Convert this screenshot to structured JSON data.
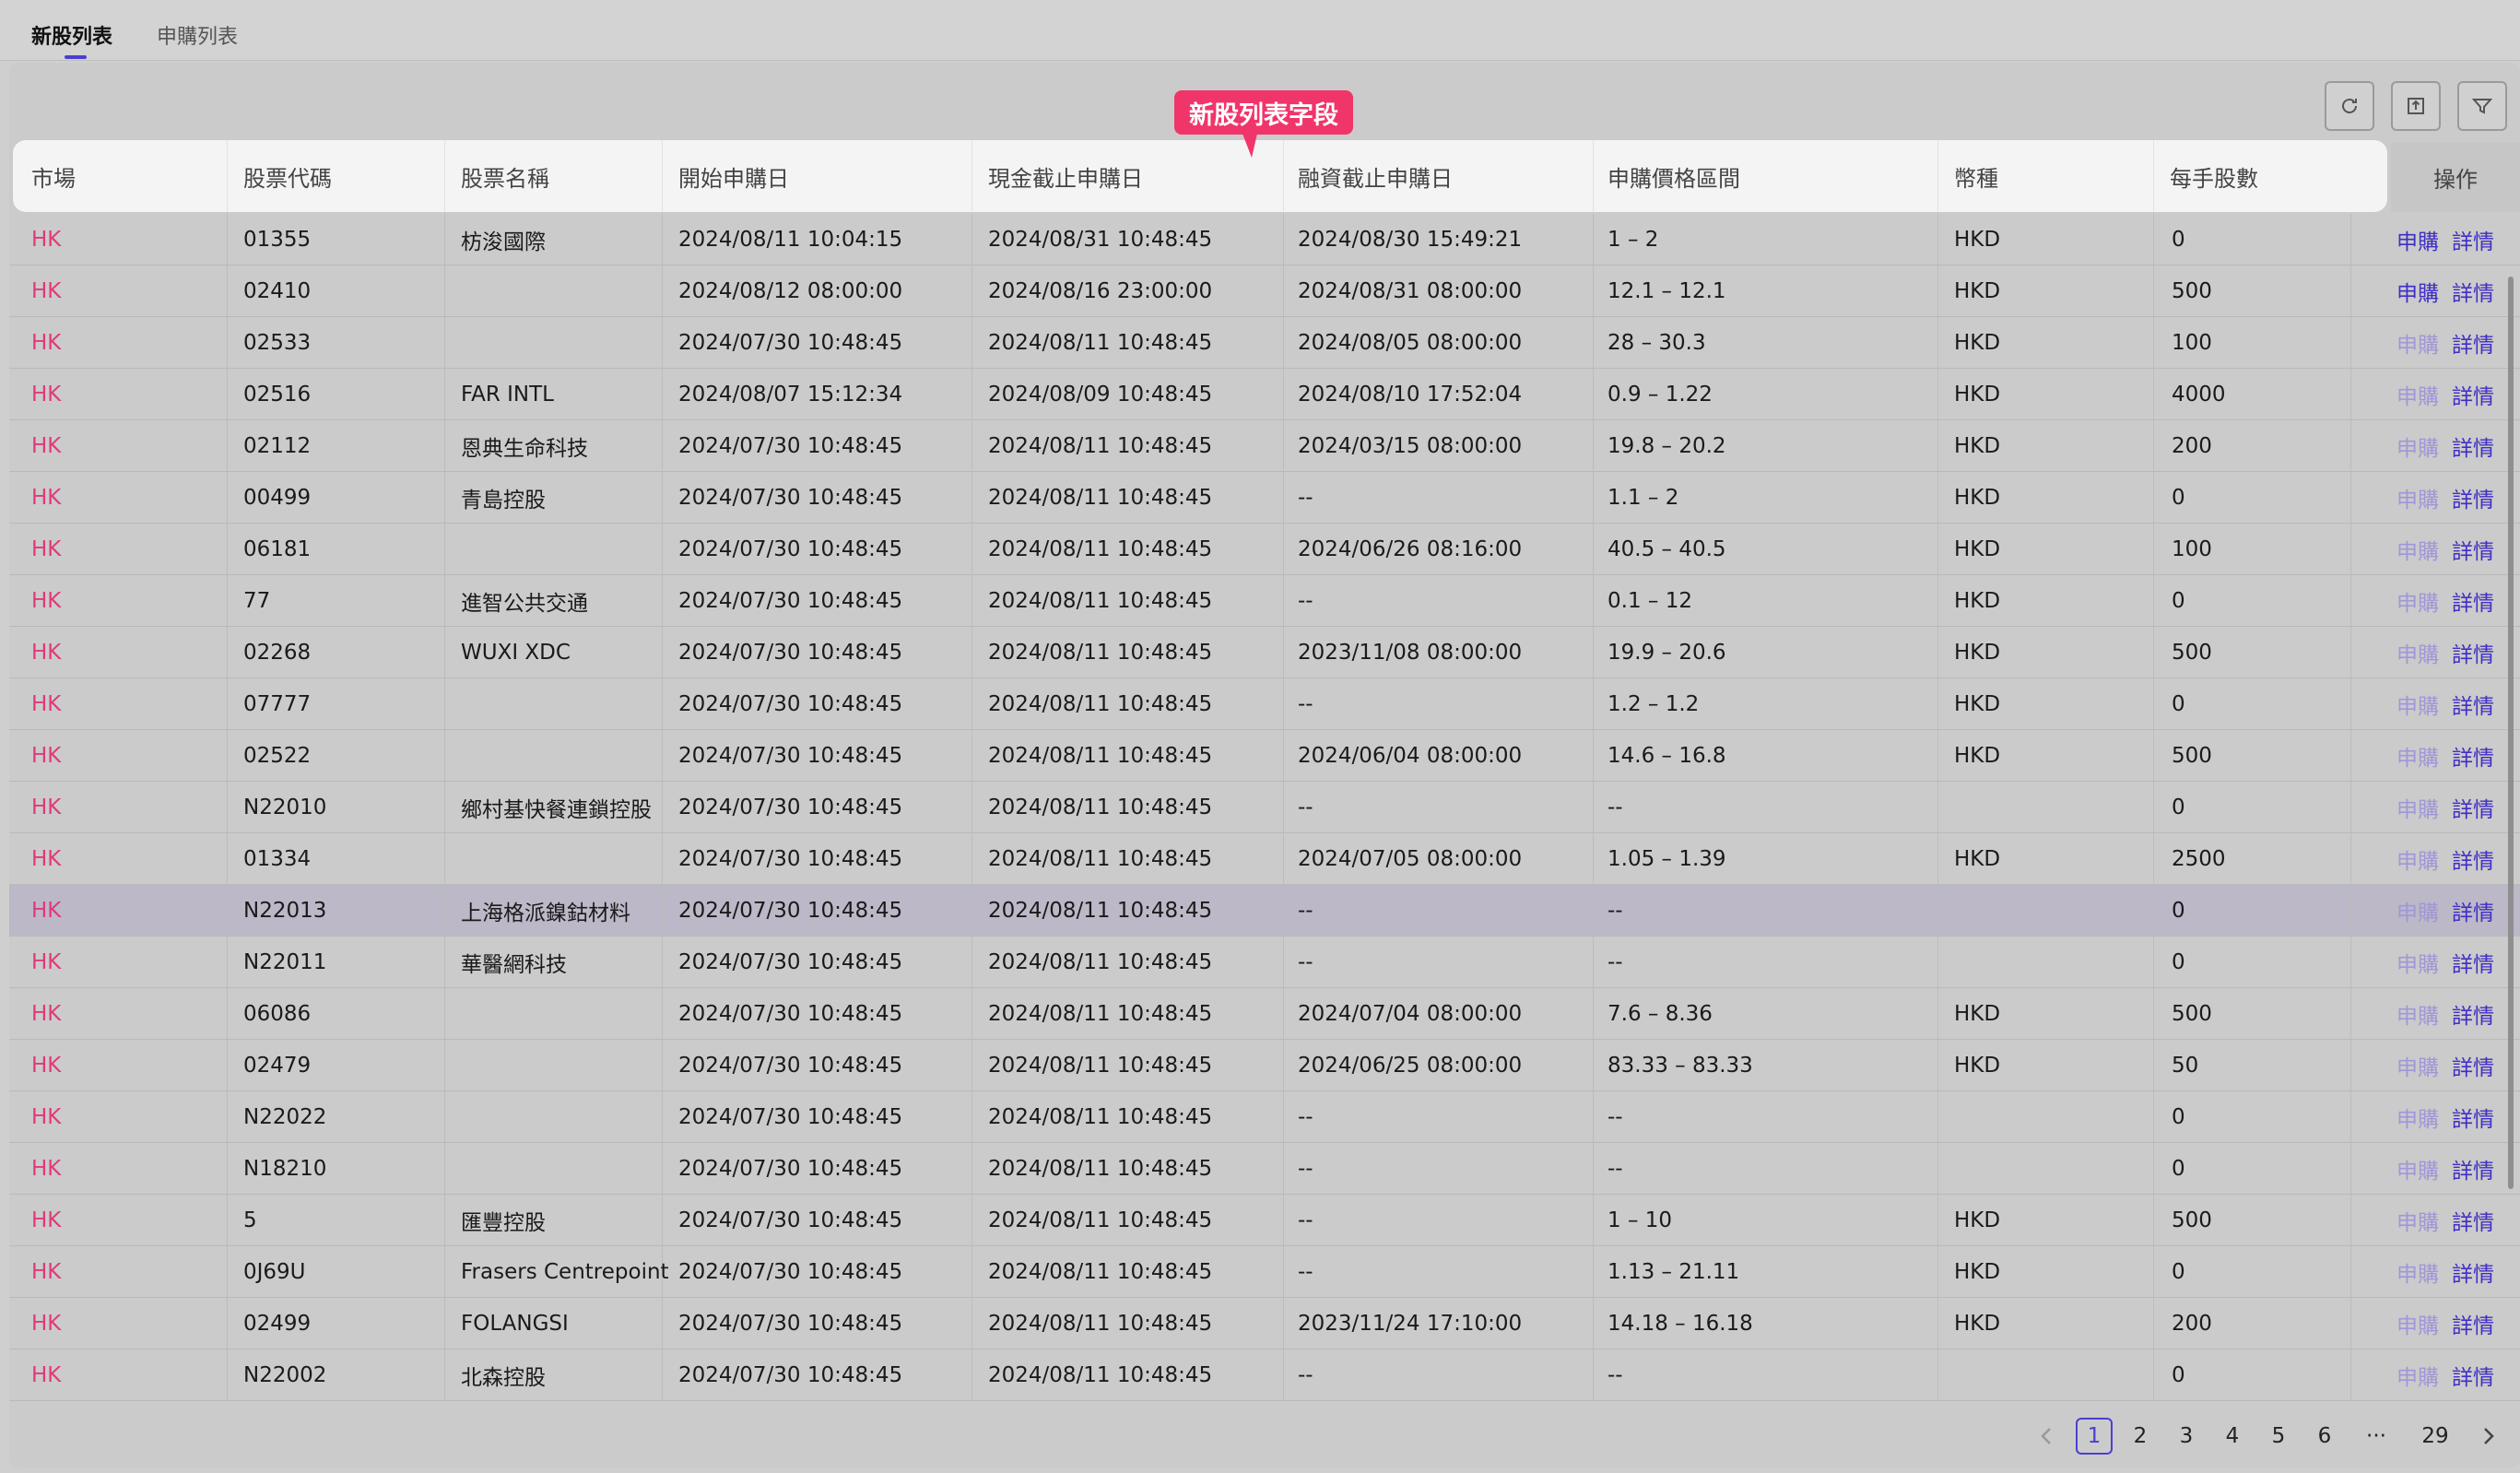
{
  "tabs": [
    {
      "label": "新股列表",
      "active": true
    },
    {
      "label": "申購列表",
      "active": false
    }
  ],
  "callout": "新股列表字段",
  "toolbar": {
    "refresh_icon": "refresh-icon",
    "export_icon": "export-icon",
    "filter_icon": "filter-icon"
  },
  "columns": [
    "市場",
    "股票代碼",
    "股票名稱",
    "開始申購日",
    "現金截止申購日",
    "融資截止申購日",
    "申購價格區間",
    "幣種",
    "每手股數",
    "操作"
  ],
  "action_labels": {
    "apply": "申購",
    "detail": "詳情"
  },
  "rows": [
    {
      "market": "HK",
      "code": "01355",
      "name": "枋浚國際",
      "start": "2024/08/11 10:04:15",
      "cash_end": "2024/08/31 10:48:45",
      "margin_end": "2024/08/30 15:49:21",
      "price": "1 – 2",
      "currency": "HKD",
      "lot": "0",
      "apply_enabled": true
    },
    {
      "market": "HK",
      "code": "02410",
      "name": "",
      "start": "2024/08/12 08:00:00",
      "cash_end": "2024/08/16 23:00:00",
      "margin_end": "2024/08/31 08:00:00",
      "price": "12.1 – 12.1",
      "currency": "HKD",
      "lot": "500",
      "apply_enabled": true
    },
    {
      "market": "HK",
      "code": "02533",
      "name": "",
      "start": "2024/07/30 10:48:45",
      "cash_end": "2024/08/11 10:48:45",
      "margin_end": "2024/08/05 08:00:00",
      "price": "28 – 30.3",
      "currency": "HKD",
      "lot": "100",
      "apply_enabled": false
    },
    {
      "market": "HK",
      "code": "02516",
      "name": "FAR INTL",
      "start": "2024/08/07 15:12:34",
      "cash_end": "2024/08/09 10:48:45",
      "margin_end": "2024/08/10 17:52:04",
      "price": "0.9 – 1.22",
      "currency": "HKD",
      "lot": "4000",
      "apply_enabled": false
    },
    {
      "market": "HK",
      "code": "02112",
      "name": "恩典生命科技",
      "start": "2024/07/30 10:48:45",
      "cash_end": "2024/08/11 10:48:45",
      "margin_end": "2024/03/15 08:00:00",
      "price": "19.8 – 20.2",
      "currency": "HKD",
      "lot": "200",
      "apply_enabled": false
    },
    {
      "market": "HK",
      "code": "00499",
      "name": "青島控股",
      "start": "2024/07/30 10:48:45",
      "cash_end": "2024/08/11 10:48:45",
      "margin_end": "--",
      "price": "1.1 – 2",
      "currency": "HKD",
      "lot": "0",
      "apply_enabled": false
    },
    {
      "market": "HK",
      "code": "06181",
      "name": "",
      "start": "2024/07/30 10:48:45",
      "cash_end": "2024/08/11 10:48:45",
      "margin_end": "2024/06/26 08:16:00",
      "price": "40.5 – 40.5",
      "currency": "HKD",
      "lot": "100",
      "apply_enabled": false
    },
    {
      "market": "HK",
      "code": "77",
      "name": "進智公共交通",
      "start": "2024/07/30 10:48:45",
      "cash_end": "2024/08/11 10:48:45",
      "margin_end": "--",
      "price": "0.1 – 12",
      "currency": "HKD",
      "lot": "0",
      "apply_enabled": false
    },
    {
      "market": "HK",
      "code": "02268",
      "name": "WUXI XDC",
      "start": "2024/07/30 10:48:45",
      "cash_end": "2024/08/11 10:48:45",
      "margin_end": "2023/11/08 08:00:00",
      "price": "19.9 – 20.6",
      "currency": "HKD",
      "lot": "500",
      "apply_enabled": false
    },
    {
      "market": "HK",
      "code": "07777",
      "name": "",
      "start": "2024/07/30 10:48:45",
      "cash_end": "2024/08/11 10:48:45",
      "margin_end": "--",
      "price": "1.2 – 1.2",
      "currency": "HKD",
      "lot": "0",
      "apply_enabled": false
    },
    {
      "market": "HK",
      "code": "02522",
      "name": "",
      "start": "2024/07/30 10:48:45",
      "cash_end": "2024/08/11 10:48:45",
      "margin_end": "2024/06/04 08:00:00",
      "price": "14.6 – 16.8",
      "currency": "HKD",
      "lot": "500",
      "apply_enabled": false
    },
    {
      "market": "HK",
      "code": "N22010",
      "name": "鄉村基快餐連鎖控股",
      "start": "2024/07/30 10:48:45",
      "cash_end": "2024/08/11 10:48:45",
      "margin_end": "--",
      "price": "--",
      "currency": "",
      "lot": "0",
      "apply_enabled": false
    },
    {
      "market": "HK",
      "code": "01334",
      "name": "",
      "start": "2024/07/30 10:48:45",
      "cash_end": "2024/08/11 10:48:45",
      "margin_end": "2024/07/05 08:00:00",
      "price": "1.05 – 1.39",
      "currency": "HKD",
      "lot": "2500",
      "apply_enabled": false
    },
    {
      "market": "HK",
      "code": "N22013",
      "name": "上海格派鎳鈷材料",
      "start": "2024/07/30 10:48:45",
      "cash_end": "2024/08/11 10:48:45",
      "margin_end": "--",
      "price": "--",
      "currency": "",
      "lot": "0",
      "apply_enabled": false,
      "highlight": true
    },
    {
      "market": "HK",
      "code": "N22011",
      "name": "華醫網科技",
      "start": "2024/07/30 10:48:45",
      "cash_end": "2024/08/11 10:48:45",
      "margin_end": "--",
      "price": "--",
      "currency": "",
      "lot": "0",
      "apply_enabled": false
    },
    {
      "market": "HK",
      "code": "06086",
      "name": "",
      "start": "2024/07/30 10:48:45",
      "cash_end": "2024/08/11 10:48:45",
      "margin_end": "2024/07/04 08:00:00",
      "price": "7.6 – 8.36",
      "currency": "HKD",
      "lot": "500",
      "apply_enabled": false
    },
    {
      "market": "HK",
      "code": "02479",
      "name": "",
      "start": "2024/07/30 10:48:45",
      "cash_end": "2024/08/11 10:48:45",
      "margin_end": "2024/06/25 08:00:00",
      "price": "83.33 – 83.33",
      "currency": "HKD",
      "lot": "50",
      "apply_enabled": false
    },
    {
      "market": "HK",
      "code": "N22022",
      "name": "",
      "start": "2024/07/30 10:48:45",
      "cash_end": "2024/08/11 10:48:45",
      "margin_end": "--",
      "price": "--",
      "currency": "",
      "lot": "0",
      "apply_enabled": false
    },
    {
      "market": "HK",
      "code": "N18210",
      "name": "",
      "start": "2024/07/30 10:48:45",
      "cash_end": "2024/08/11 10:48:45",
      "margin_end": "--",
      "price": "--",
      "currency": "",
      "lot": "0",
      "apply_enabled": false
    },
    {
      "market": "HK",
      "code": "5",
      "name": "匯豐控股",
      "start": "2024/07/30 10:48:45",
      "cash_end": "2024/08/11 10:48:45",
      "margin_end": "--",
      "price": "1 – 10",
      "currency": "HKD",
      "lot": "500",
      "apply_enabled": false
    },
    {
      "market": "HK",
      "code": "0J69U",
      "name": "Frasers Centrepoint",
      "start": "2024/07/30 10:48:45",
      "cash_end": "2024/08/11 10:48:45",
      "margin_end": "--",
      "price": "1.13 – 21.11",
      "currency": "HKD",
      "lot": "0",
      "apply_enabled": false
    },
    {
      "market": "HK",
      "code": "02499",
      "name": "FOLANGSI",
      "start": "2024/07/30 10:48:45",
      "cash_end": "2024/08/11 10:48:45",
      "margin_end": "2023/11/24 17:10:00",
      "price": "14.18 – 16.18",
      "currency": "HKD",
      "lot": "200",
      "apply_enabled": false
    },
    {
      "market": "HK",
      "code": "N22002",
      "name": "北森控股",
      "start": "2024/07/30 10:48:45",
      "cash_end": "2024/08/11 10:48:45",
      "margin_end": "--",
      "price": "--",
      "currency": "",
      "lot": "0",
      "apply_enabled": false
    }
  ],
  "pagination": {
    "prev_icon": "chevron-left-icon",
    "next_icon": "chevron-right-icon",
    "pages": [
      "1",
      "2",
      "3",
      "4",
      "5",
      "6"
    ],
    "ellipsis": "···",
    "last": "29",
    "current": "1"
  },
  "colors": {
    "accent": "#4b3fd0",
    "market": "#e0397a",
    "callout": "#f0356a"
  }
}
